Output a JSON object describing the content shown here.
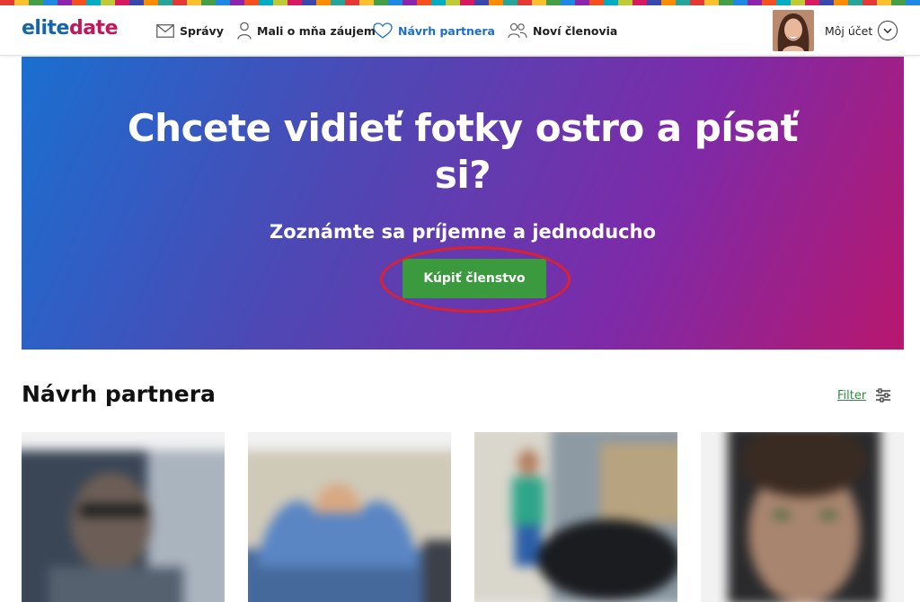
{
  "stripe_colors": [
    "#e53935",
    "#fbc02d",
    "#43a047",
    "#1e88e5",
    "#8e24aa",
    "#f4511e",
    "#00acc1",
    "#c0ca33",
    "#d81b60",
    "#3949ab",
    "#fb8c00",
    "#26a69a"
  ],
  "brand": {
    "logo_part1": "elite",
    "logo_part2": "date"
  },
  "nav": {
    "messages": "Správy",
    "interested": "Mali o mňa záujem",
    "suggestion": "Návrh partnera",
    "new_members": "Noví členovia",
    "account": "Môj účet"
  },
  "hero": {
    "title": "Chcete vidieť fotky ostro a písať si?",
    "subtitle": "Zoznámte sa príjemne a jednoducho",
    "button": "Kúpiť členstvo"
  },
  "section": {
    "title": "Návrh partnera",
    "filter": "Filter"
  },
  "colors": {
    "accent_blue": "#1b6fc4",
    "button_green": "#3b9a3e",
    "highlight_red": "#e0202a"
  }
}
